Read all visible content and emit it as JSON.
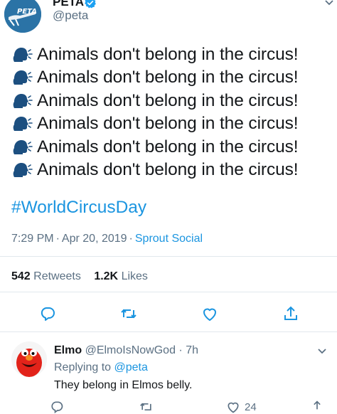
{
  "tweet": {
    "display_name": "PETA",
    "handle": "@peta",
    "avatar_text": "PETA",
    "lines": [
      "Animals don't belong in the circus!",
      "Animals don't belong in the circus!",
      "Animals don't belong in the circus!",
      "Animals don't belong in the circus!",
      "Animals don't belong in the circus!",
      "Animals don't belong in the circus!"
    ],
    "hashtag": "#WorldCircusDay",
    "time": "7:29 PM",
    "date": "Apr 20, 2019",
    "source": "Sprout Social",
    "retweets_count": "542",
    "retweets_label": "Retweets",
    "likes_count": "1.2K",
    "likes_label": "Likes"
  },
  "reply": {
    "name": "Elmo",
    "handle": "@ElmoIsNowGod",
    "age": "7h",
    "replying_prefix": "Replying to",
    "replying_to": "@peta",
    "text": "They belong in Elmos belly.",
    "like_count": "24"
  },
  "icons": {
    "line_emoji": "speaking-head-icon",
    "verified": "verified-badge-icon",
    "reply": "reply-icon",
    "retweet": "retweet-icon",
    "like": "heart-icon",
    "share": "share-icon",
    "more": "chevron-down-icon"
  },
  "colors": {
    "link": "#1b95e0",
    "secondary": "#5b7083",
    "verified": "#1da1f2",
    "peta_blue": "#2b73a6",
    "elmo_red": "#e2231a"
  }
}
